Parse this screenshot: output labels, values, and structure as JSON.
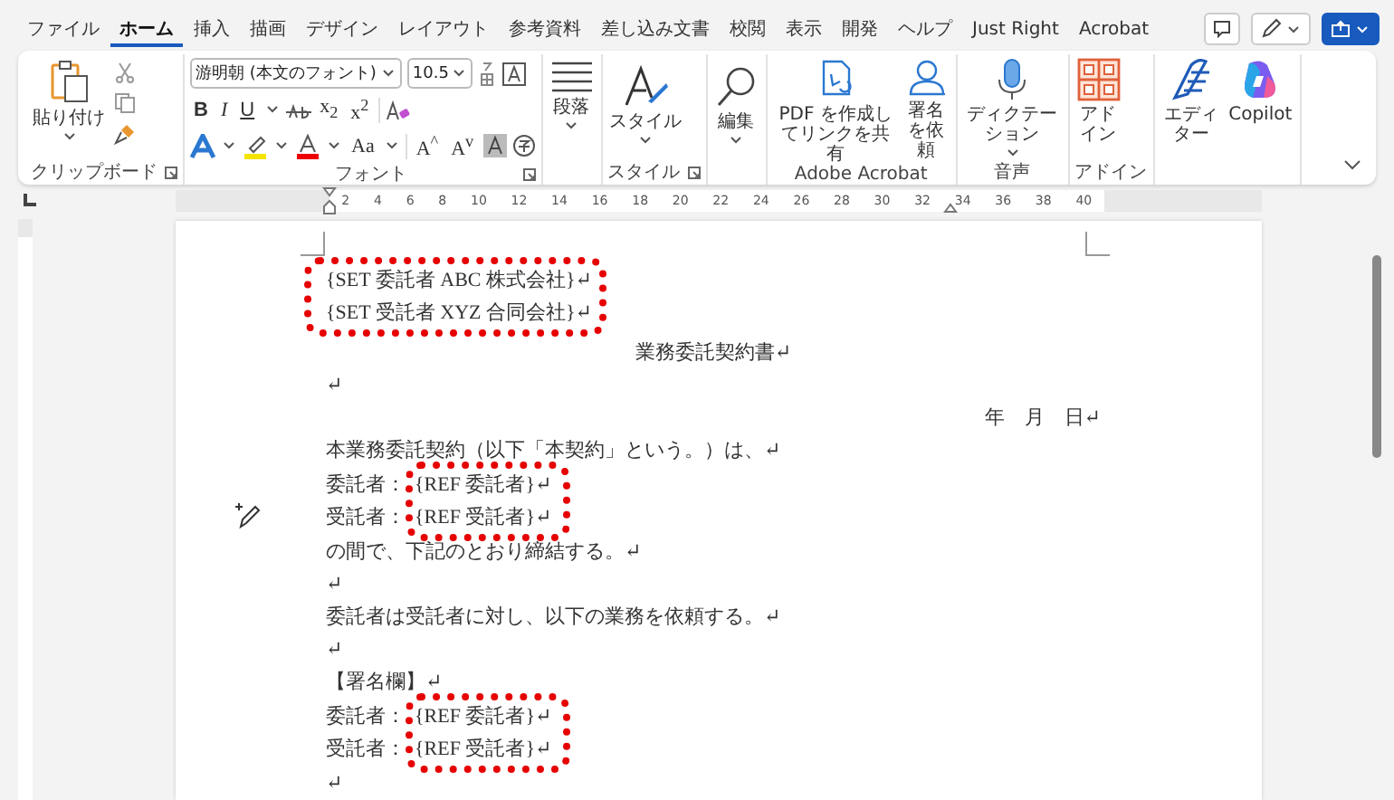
{
  "menu_tabs": [
    {
      "label": "ファイル",
      "selected": false
    },
    {
      "label": "ホーム",
      "selected": true
    },
    {
      "label": "挿入",
      "selected": false
    },
    {
      "label": "描画",
      "selected": false
    },
    {
      "label": "デザイン",
      "selected": false
    },
    {
      "label": "レイアウト",
      "selected": false
    },
    {
      "label": "参考資料",
      "selected": false
    },
    {
      "label": "差し込み文書",
      "selected": false
    },
    {
      "label": "校閲",
      "selected": false
    },
    {
      "label": "表示",
      "selected": false
    },
    {
      "label": "開発",
      "selected": false
    },
    {
      "label": "ヘルプ",
      "selected": false
    },
    {
      "label": "Just Right",
      "selected": false
    },
    {
      "label": "Acrobat",
      "selected": false
    }
  ],
  "ribbon": {
    "clipboard": {
      "paste": "貼り付け",
      "group": "クリップボード"
    },
    "font": {
      "font_name": "游明朝 (本文のフォント)",
      "font_size": "10.5",
      "bold": "B",
      "italic": "I",
      "underline": "U",
      "subscript": "x$_{2}$",
      "superscript": "x$^{2}$",
      "change_case": "Aa",
      "grow": "A$^{^}$",
      "shrink": "A$^{v}$",
      "group": "フォント"
    },
    "paragraph": {
      "label": "段落"
    },
    "styles": {
      "label": "スタイル",
      "group": "スタイル"
    },
    "editing": {
      "label": "編集"
    },
    "acrobat": {
      "buttons": [
        "PDF を作成してリンクを共有",
        "署名を依頼"
      ],
      "group": "Adobe Acrobat"
    },
    "voice": {
      "label": "ディクテーション",
      "group": "音声"
    },
    "addins": {
      "label": "アドイン",
      "group": "アドイン"
    },
    "extras": {
      "editor": "エディター",
      "copilot": "Copilot"
    }
  },
  "ruler": {
    "ticks": [
      "2",
      "4",
      "6",
      "8",
      "10",
      "12",
      "14",
      "16",
      "18",
      "20",
      "22",
      "24",
      "26",
      "28",
      "30",
      "32",
      "34",
      "36",
      "38",
      "40"
    ]
  },
  "document": {
    "blocks": [
      {
        "kind": "set-group",
        "lines": [
          "{SET  委託者  ABC 株式会社}↵",
          "{SET  受託者  XYZ 合同会社}↵"
        ]
      },
      {
        "kind": "title",
        "text": "業務委託契約書↵"
      },
      {
        "kind": "text",
        "text": "↵"
      },
      {
        "kind": "date",
        "text": "年　月　日↵"
      },
      {
        "kind": "text",
        "text": "本業務委託契約（以下「本契約」という。）は、↵"
      },
      {
        "kind": "ref-group",
        "rows": [
          {
            "label": "委託者：",
            "field": "{REF  委託者}↵"
          },
          {
            "label": "受託者：",
            "field": "{REF  受託者}↵"
          }
        ]
      },
      {
        "kind": "text",
        "text": "の間で、下記のとおり締結する。↵"
      },
      {
        "kind": "text",
        "text": "↵"
      },
      {
        "kind": "text",
        "text": "委託者は受託者に対し、以下の業務を依頼する。↵"
      },
      {
        "kind": "text",
        "text": "↵"
      },
      {
        "kind": "text",
        "text": "【署名欄】↵"
      },
      {
        "kind": "ref-group",
        "rows": [
          {
            "label": "委託者：",
            "field": "{REF  委託者}↵"
          },
          {
            "label": "受託者：",
            "field": "{REF  受託者}↵"
          }
        ]
      },
      {
        "kind": "text",
        "text": "↵"
      }
    ]
  }
}
